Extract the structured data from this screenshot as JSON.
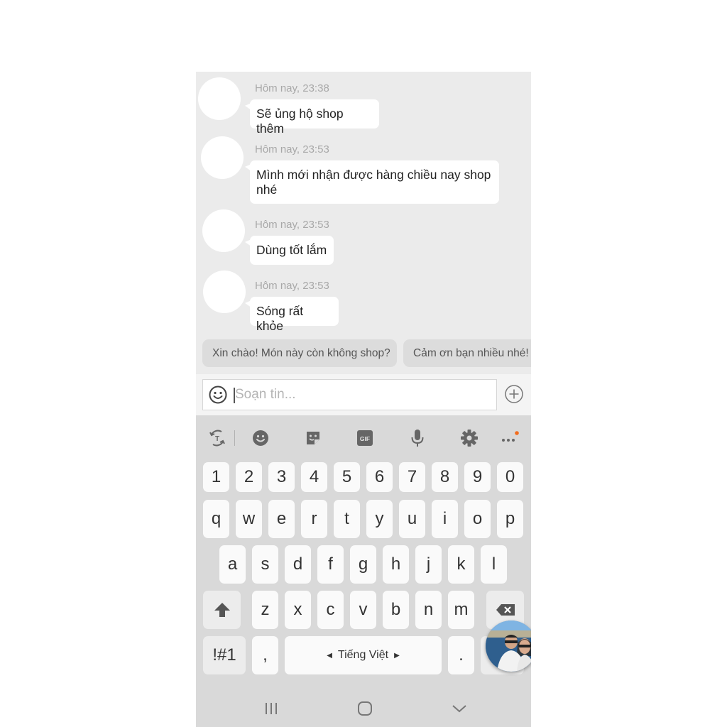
{
  "chat": {
    "messages": [
      {
        "time": "Hôm nay, 23:38",
        "text": "Sẽ ủng hộ shop thêm"
      },
      {
        "time": "Hôm nay, 23:53",
        "text": "Mình mới nhận được hàng chiều nay shop nhé"
      },
      {
        "time": "Hôm nay, 23:53",
        "text": "Dùng tốt lắm"
      },
      {
        "time": "Hôm nay, 23:53",
        "text": "Sóng rất khỏe"
      }
    ],
    "quick_replies": [
      "Xin chào! Món này còn không shop?",
      "Cảm ơn bạn nhiều nhé!"
    ]
  },
  "composer": {
    "placeholder": "Soạn tin...",
    "value": "",
    "emoji_icon": "smiley-outline-icon",
    "attach_icon": "plus-circle-icon"
  },
  "keyboard": {
    "toolbar": [
      {
        "name": "translate-icon"
      },
      {
        "name": "emoji-icon"
      },
      {
        "name": "sticker-icon"
      },
      {
        "name": "gif-icon",
        "label": "GIF"
      },
      {
        "name": "microphone-icon"
      },
      {
        "name": "settings-icon"
      },
      {
        "name": "more-icon",
        "badge_color": "#f26c1d"
      }
    ],
    "row_numbers": [
      "1",
      "2",
      "3",
      "4",
      "5",
      "6",
      "7",
      "8",
      "9",
      "0"
    ],
    "row_top": [
      "q",
      "w",
      "e",
      "r",
      "t",
      "y",
      "u",
      "i",
      "o",
      "p"
    ],
    "row_middle": [
      "a",
      "s",
      "d",
      "f",
      "g",
      "h",
      "j",
      "k",
      "l"
    ],
    "row_bottom": [
      "z",
      "x",
      "c",
      "v",
      "b",
      "n",
      "m"
    ],
    "symbols_label": "!#1",
    "comma_label": ",",
    "space_label": "Tiếng Việt",
    "period_label": "."
  },
  "navbar": {
    "recents_icon": "recent-apps-icon",
    "home_icon": "home-icon",
    "back_icon": "hide-keyboard-icon"
  }
}
